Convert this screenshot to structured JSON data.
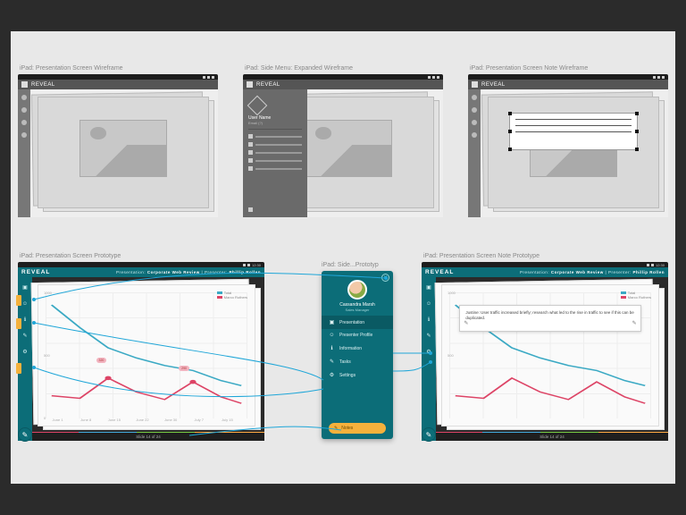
{
  "brand": "REVEAL",
  "captions": {
    "wf1": "iPad: Presentation Screen Wireframe",
    "wf2": "iPad: Side Menu: Expanded Wireframe",
    "wf3": "iPad: Presentation Screen Note Wireframe",
    "pt1": "iPad: Presentation Screen Prototype",
    "pt2": "iPad: Side...Prototyp",
    "pt3": "iPad: Presentation Screen Note Prototype"
  },
  "status_time": "12:30",
  "header_meta": {
    "presentation_label": "Presentation:",
    "presentation_value": "Corporate Web Review",
    "presenter_label": "Presenter:",
    "presenter_value": "Phillip Rollen"
  },
  "footer": {
    "text": "Slide 14 of 24"
  },
  "wf_menu": {
    "username": "User Name",
    "subtitle": "Email (?)"
  },
  "proto_menu": {
    "username": "Cassandra Marsh",
    "role": "Sales Manager",
    "items": [
      {
        "icon": "▣",
        "label": "Presentation",
        "active": true
      },
      {
        "icon": "☺",
        "label": "Presenter Profile"
      },
      {
        "icon": "ℹ",
        "label": "Information"
      },
      {
        "icon": "✎",
        "label": "Tasks"
      },
      {
        "icon": "⚙",
        "label": "Settings"
      }
    ],
    "notes_label": "Notes"
  },
  "note_text": "Justine: User traffic increased briefly; research what led to the rise in traffic to see if this can be duplicated.",
  "chart_data": {
    "type": "line",
    "x": [
      "June 1",
      "June 8",
      "June 15",
      "June 22",
      "June 30",
      "July 7",
      "July 15",
      "July 22"
    ],
    "series": [
      {
        "name": "Total",
        "color": "#3aa9c4",
        "values": [
          900,
          720,
          560,
          480,
          420,
          380,
          300,
          260
        ]
      },
      {
        "name": "Marco Ruthers",
        "color": "#d46",
        "values": [
          180,
          160,
          320,
          210,
          150,
          290,
          170,
          120
        ]
      }
    ],
    "ylim": [
      0,
      1000
    ],
    "yticks": [
      0,
      500,
      1000
    ],
    "annotations": [
      {
        "x_index": 2,
        "series": 1,
        "label": "320"
      },
      {
        "x_index": 5,
        "series": 1,
        "label": "290"
      }
    ],
    "legend": [
      "Total",
      "Marco Ruthers"
    ]
  }
}
